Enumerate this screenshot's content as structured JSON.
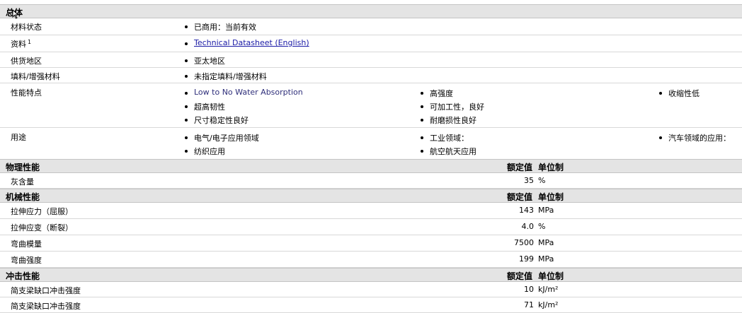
{
  "general": {
    "title": "总体",
    "rows": {
      "status": {
        "label": "材料状态",
        "value": "已商用：当前有效"
      },
      "docs": {
        "label": "资料",
        "sup": "1",
        "value": "Technical Datasheet (English)"
      },
      "region": {
        "label": "供货地区",
        "value": "亚太地区"
      },
      "filler": {
        "label": "填料/增强材料",
        "value": "未指定填料/增强材料"
      },
      "features": {
        "label": "性能特点",
        "col1": [
          "Low to No Water Absorption",
          "超高韧性",
          "尺寸稳定性良好"
        ],
        "col2": [
          "高强度",
          "可加工性，良好",
          "耐磨损性良好"
        ],
        "col3": [
          "收缩性低"
        ]
      },
      "uses": {
        "label": "用途",
        "col1": [
          "电气/电子应用领域",
          "纺织应用"
        ],
        "col2": [
          "工业领域：",
          "航空航天应用"
        ],
        "col3": [
          "汽车领域的应用："
        ]
      }
    }
  },
  "physical": {
    "title": "物理性能",
    "value_header": "额定值",
    "unit_header": "单位制",
    "rows": [
      {
        "label": "灰含量",
        "value": "35",
        "unit": "%"
      }
    ]
  },
  "mechanical": {
    "title": "机械性能",
    "value_header": "额定值",
    "unit_header": "单位制",
    "rows": [
      {
        "label": "拉伸应力（屈服）",
        "value": "143",
        "unit": "MPa"
      },
      {
        "label": "拉伸应变（断裂）",
        "value": "4.0",
        "unit": "%"
      },
      {
        "label": "弯曲模量",
        "value": "7500",
        "unit": "MPa"
      },
      {
        "label": "弯曲强度",
        "value": "199",
        "unit": "MPa"
      }
    ]
  },
  "impact": {
    "title": "冲击性能",
    "value_header": "额定值",
    "unit_header": "单位制",
    "rows": [
      {
        "label": "简支梁缺口冲击强度",
        "value": "10",
        "unit": "kJ/m²"
      },
      {
        "label": "简支梁缺口冲击强度",
        "value": "71",
        "unit": "kJ/m²"
      }
    ]
  }
}
